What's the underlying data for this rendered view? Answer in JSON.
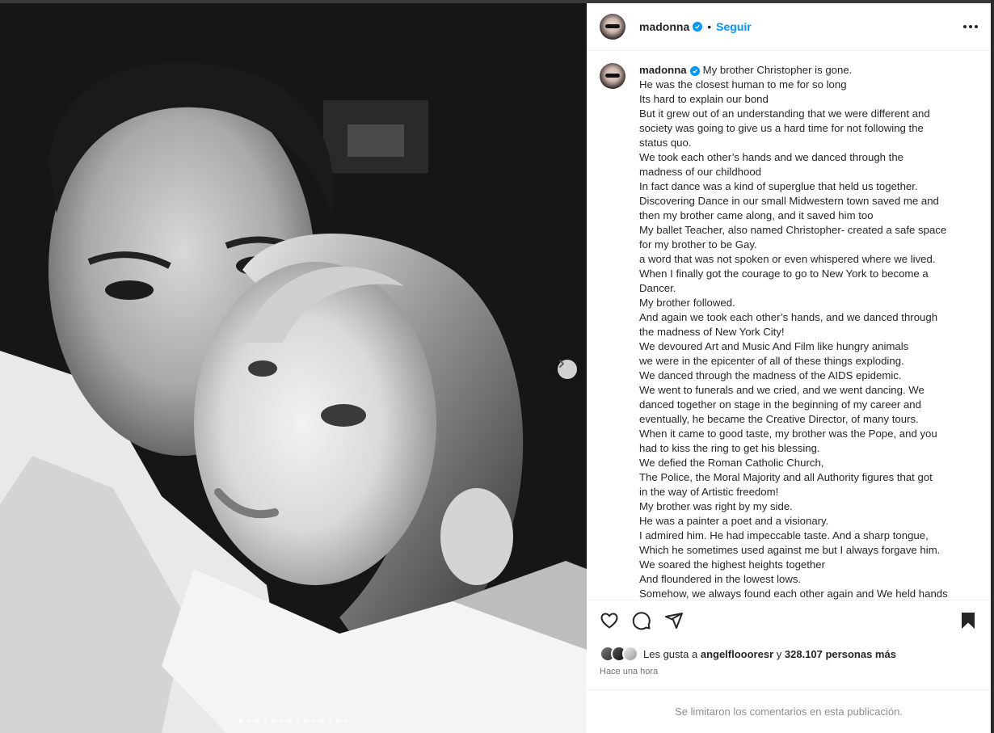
{
  "post": {
    "username": "madonna",
    "follow_label": "Seguir",
    "separator": "•",
    "caption_lines": [
      "My brother Christopher is gone.",
      "He was the closest human to me for so long",
      "Its hard to explain our bond",
      "But it grew out of an understanding that we were different and",
      "society was going to give us a hard time for not following the",
      "status quo.",
      "We took each other’s hands and we danced through the",
      "madness of our childhood",
      "In fact dance was a kind of superglue that held us together.",
      "Discovering Dance in our small Midwestern town saved me and",
      "then my brother came along, and it saved him too",
      "My ballet Teacher, also named Christopher- created a safe space",
      "for my brother to be Gay.",
      "a word that was not spoken or even whispered where we lived.",
      "When I finally got the courage to go to New York to become a",
      "Dancer.",
      "My brother followed.",
      "And again we took each other’s hands, and we danced through",
      "the madness of New York City!",
      "We devoured Art and Music And Film like hungry animals",
      "we were in the epicenter of all of these things exploding.",
      "We danced through the madness of the AIDS epidemic.",
      "We went to funerals and we cried, and we went dancing. We",
      "danced together on stage in the beginning of my career and",
      "eventually, he became the Creative Director, of many tours.",
      "When it came to good taste, my brother was the Pope, and you",
      "had to kiss the ring to get his blessing.",
      "We defied the Roman Catholic Church,",
      "The Police, the Moral Majority and all Authority figures that got",
      "in the way of Artistic freedom!",
      "My brother was right by my side.",
      "He was a painter a poet and a visionary.",
      "I admired him. He had impeccable taste. And a sharp tongue,",
      "Which he sometimes used against me but I always forgave him.",
      "We soared the highest heights together",
      "And floundered in the lowest lows.",
      "Somehow, we always found each other again and We held hands"
    ],
    "likes": {
      "prefix": "Les gusta a",
      "user": "angelfloooresr",
      "suffix_y": "y",
      "count_text": "328.107 personas más"
    },
    "timestamp": "Hace una hora",
    "comments_notice": "Se limitaron los comentarios en esta publicación."
  },
  "icons": {
    "verified": "verified-badge-icon",
    "more": "more-options-icon",
    "like": "heart-icon",
    "comment": "comment-icon",
    "share": "share-icon",
    "save": "bookmark-icon",
    "next": "chevron-right-icon"
  },
  "colors": {
    "accent": "#0095f6",
    "text": "#262626",
    "muted": "#737373",
    "border": "#efefef"
  },
  "carousel": {
    "total_slides": 14,
    "active_slide": 1
  }
}
